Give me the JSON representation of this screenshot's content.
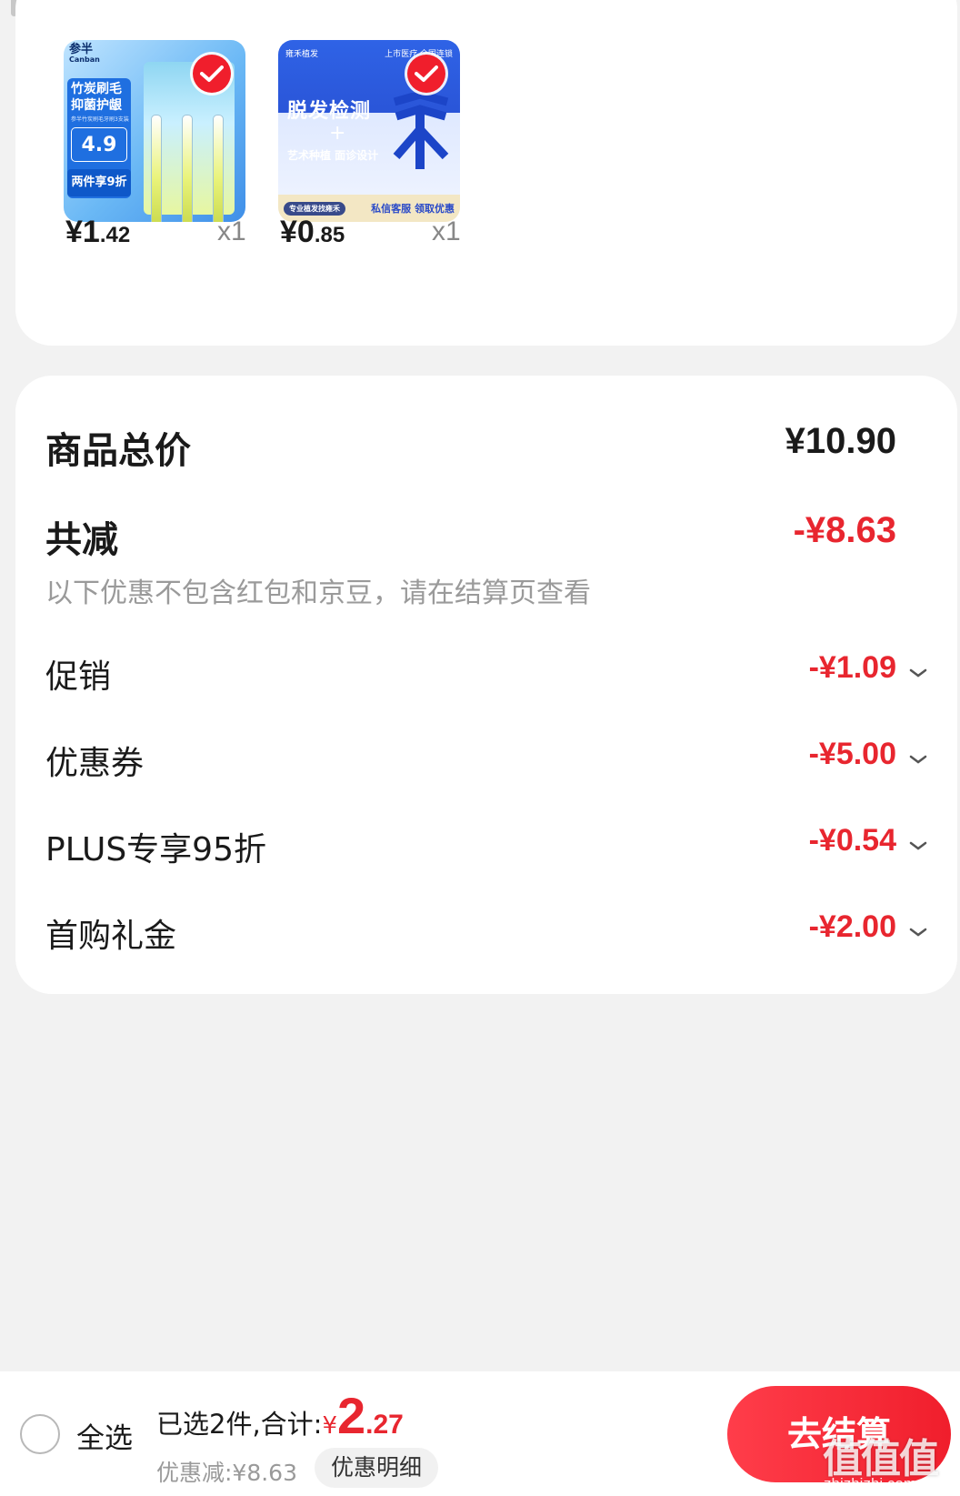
{
  "products": [
    {
      "name": "参半竹炭刷毛抑菌护龈牙刷",
      "thumb": {
        "brand": "参半",
        "brand_en": "Canban",
        "headline": "竹炭刷毛 抑菌护龈",
        "sub": "参半竹炭刷毛牙刷3支装",
        "price": "4.9",
        "deal": "两件享9折"
      },
      "price_int": "¥1",
      "price_dec": ".42",
      "quantity": "x1",
      "selected": true
    },
    {
      "name": "雍禾植发 脱发检测",
      "thumb": {
        "brand": "雍禾植发",
        "tag": "上市医疗 全国连锁",
        "headline": "脱发检测",
        "plus": "+",
        "line": "艺术种植 面诊设计",
        "footer_left": "专业植发找雍禾",
        "footer_right": "私信客服 领取优惠"
      },
      "price_int": "¥0",
      "price_dec": ".85",
      "quantity": "x1",
      "selected": true
    }
  ],
  "summary": {
    "total_label": "商品总价",
    "total_value": "¥10.90",
    "saved_label": "共减",
    "saved_value": "-¥8.63",
    "note": "以下优惠不包含红包和京豆，请在结算页查看",
    "discounts": [
      {
        "label": "促销",
        "value": "-¥1.09"
      },
      {
        "label": "优惠券",
        "value": "-¥5.00"
      },
      {
        "label": "PLUS专享95折",
        "value": "-¥0.54"
      },
      {
        "label": "首购礼金",
        "value": "-¥2.00"
      }
    ]
  },
  "bottom_bar": {
    "select_all_label": "全选",
    "selected_prefix": "已选2件,合计:",
    "currency": "¥",
    "total_int": "2",
    "total_dec": ".27",
    "discount_label": "优惠减:¥8.63",
    "discount_detail_label": "优惠明细",
    "checkout_label": "去结算",
    "watermark": "值值值",
    "watermark_url": "zhizhizhi.com"
  },
  "colors": {
    "accent_red": "#e8262f",
    "check_red": "#f01e2c",
    "background": "#f2f2f2",
    "muted_text": "#9a9a9a"
  },
  "icons": [
    "check-icon",
    "chevron-down-icon",
    "radio-unchecked-icon"
  ]
}
